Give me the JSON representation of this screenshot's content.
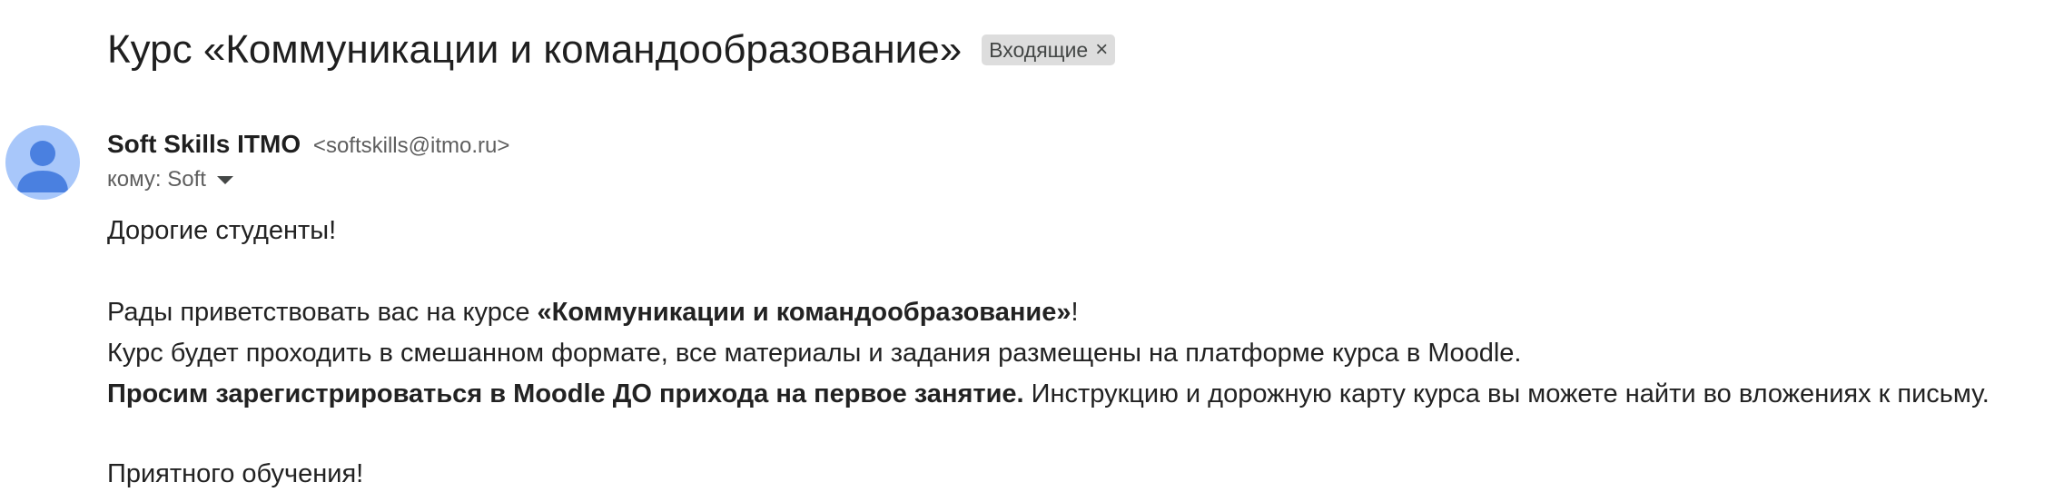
{
  "email": {
    "subject": "Курс «Коммуникации и командообразование»",
    "label": "Входящие",
    "label_remove_glyph": "×",
    "sender_name": "Soft Skills ITMO",
    "sender_email": "<softskills@itmo.ru>",
    "to_text": "кому: Soft",
    "body": {
      "greeting": "Дорогие студенты!",
      "welcome_prefix": "Рады приветствовать вас на курсе ",
      "welcome_bold": "«Коммуникации и командообразование»",
      "welcome_suffix": "!",
      "format_line": "Курс будет проходить в смешанном формате, все материалы и задания размещены на платформе курса в Moodle.",
      "register_bold": "Просим зарегистрироваться в Moodle ДО прихода на первое занятие.",
      "register_rest": " Инструкцию и дорожную карту курса вы можете найти во вложениях к письму.",
      "closing": "Приятного обучения!"
    }
  },
  "colors": {
    "avatar_bg": "#a8c7fa",
    "avatar_figure": "#4a80e0",
    "label_chip_bg": "#dddddd"
  },
  "icons": {
    "avatar": "person-avatar-icon",
    "label_remove": "close-icon",
    "recipient_details": "caret-down-icon"
  }
}
